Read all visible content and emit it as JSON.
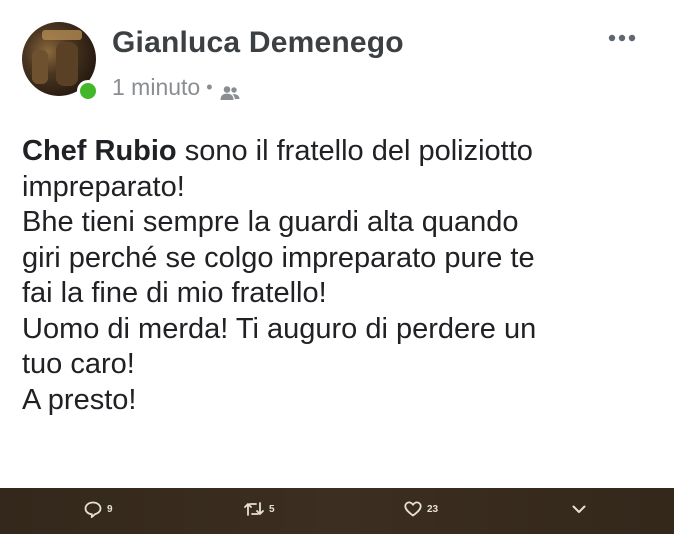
{
  "post": {
    "author": "Gianluca Demenego",
    "time": "1 minuto",
    "separator": "•",
    "audience_icon": "friends-icon",
    "more_icon": "more-dots-icon",
    "online_status_color": "#42b72a",
    "text_lines": [
      {
        "bold": "Chef Rubio",
        "rest": " sono il fratello del poliziotto"
      },
      {
        "bold": "",
        "rest": "impreparato!"
      },
      {
        "bold": "",
        "rest": "Bhe tieni sempre la guardi alta quando"
      },
      {
        "bold": "",
        "rest": "giri perché se colgo impreparato pure te"
      },
      {
        "bold": "",
        "rest": "fai la fine di mio fratello!"
      },
      {
        "bold": "",
        "rest": "Uomo di merda! Ti auguro di perdere un"
      },
      {
        "bold": "",
        "rest": "tuo caro!"
      },
      {
        "bold": "",
        "rest": "A presto!"
      }
    ]
  },
  "actions": {
    "reply": {
      "icon": "reply-icon",
      "count": "9"
    },
    "retweet": {
      "icon": "retweet-icon",
      "count": "5"
    },
    "like": {
      "icon": "heart-icon",
      "count": "23"
    },
    "more": {
      "icon": "chevron-down-icon"
    }
  },
  "colors": {
    "author": "#3c4043",
    "meta": "#8a8d91",
    "body_text": "#202124",
    "action_bar": "#3a2d20",
    "action_text": "#e6e0d6"
  }
}
